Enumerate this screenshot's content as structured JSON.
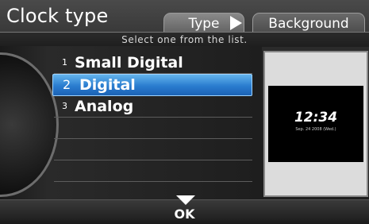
{
  "header": {
    "title": "Clock type"
  },
  "tabs": [
    {
      "label": "Type",
      "active": true
    },
    {
      "label": "Background",
      "active": false
    }
  ],
  "instruction": "Select one from the list.",
  "list": {
    "items": [
      {
        "number": "1",
        "label": "Small Digital",
        "selected": false
      },
      {
        "number": "2",
        "label": "Digital",
        "selected": true
      },
      {
        "number": "3",
        "label": "Analog",
        "selected": false
      }
    ]
  },
  "preview": {
    "time": "12:34",
    "date": "Sep. 24 2008 (Wed.)"
  },
  "footer": {
    "ok_label": "OK"
  },
  "colors": {
    "selection": "#2a7ccf",
    "background": "#2b2b2b",
    "text": "#ffffff"
  }
}
